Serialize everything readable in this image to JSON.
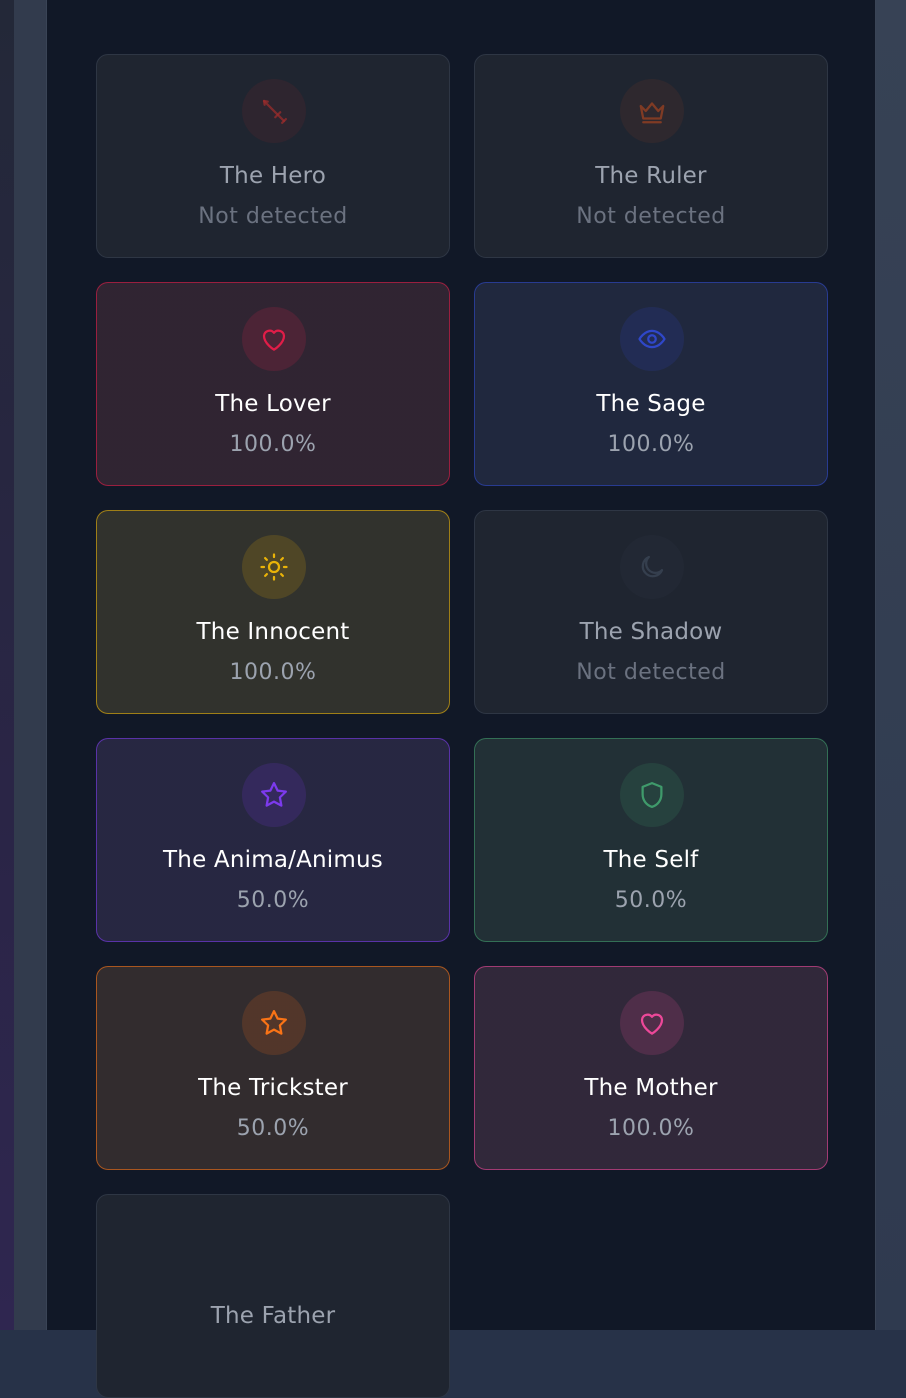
{
  "archetypes": [
    {
      "name": "The Hero",
      "value": "Not detected",
      "icon": "sword-icon",
      "active": false,
      "accent": "#9b2c2c"
    },
    {
      "name": "The Ruler",
      "value": "Not detected",
      "icon": "crown-icon",
      "active": false,
      "accent": "#9c4221"
    },
    {
      "name": "The Lover",
      "value": "100.0%",
      "icon": "heart-icon",
      "active": true,
      "accent": "#e11d48"
    },
    {
      "name": "The Sage",
      "value": "100.0%",
      "icon": "eye-icon",
      "active": true,
      "accent": "#2f47c9"
    },
    {
      "name": "The Innocent",
      "value": "100.0%",
      "icon": "sun-icon",
      "active": true,
      "accent": "#eab308"
    },
    {
      "name": "The Shadow",
      "value": "Not detected",
      "icon": "moon-icon",
      "active": false,
      "accent": "#374151"
    },
    {
      "name": "The Anima/Animus",
      "value": "50.0%",
      "icon": "star-icon",
      "active": true,
      "accent": "#7c3aed"
    },
    {
      "name": "The Self",
      "value": "50.0%",
      "icon": "shield-icon",
      "active": true,
      "accent": "#3f9a6b"
    },
    {
      "name": "The Trickster",
      "value": "50.0%",
      "icon": "star-icon",
      "active": true,
      "accent": "#f97316"
    },
    {
      "name": "The Mother",
      "value": "100.0%",
      "icon": "heart-icon",
      "active": true,
      "accent": "#ec4899"
    },
    {
      "name": "The Father",
      "value": "",
      "icon": "",
      "active": false,
      "accent": "#374151"
    }
  ]
}
